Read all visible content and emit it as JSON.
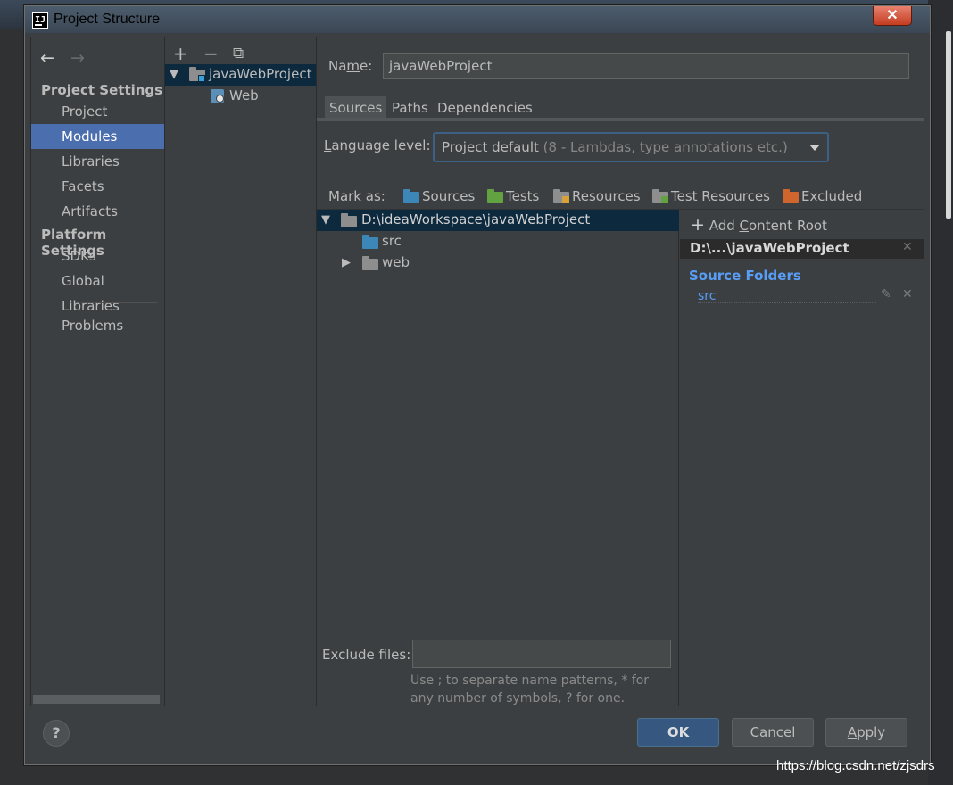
{
  "window": {
    "title": "Project Structure",
    "close_glyph": "✕"
  },
  "nav": {
    "back_glyph": "←",
    "forward_glyph": "→"
  },
  "sidebar": {
    "project_settings_header": "Project Settings",
    "project_items": [
      {
        "label": "Project",
        "selected": false
      },
      {
        "label": "Modules",
        "selected": true
      },
      {
        "label": "Libraries",
        "selected": false
      },
      {
        "label": "Facets",
        "selected": false
      },
      {
        "label": "Artifacts",
        "selected": false
      }
    ],
    "platform_settings_header": "Platform Settings",
    "platform_items": [
      {
        "label": "SDKs"
      },
      {
        "label": "Global Libraries"
      }
    ],
    "problems_label": "Problems"
  },
  "module_tree": {
    "toolbar": {
      "add_glyph": "+",
      "remove_glyph": "−",
      "copy_glyph": "⧉"
    },
    "root": {
      "label": "javaWebProject",
      "expanded": true
    },
    "children": [
      {
        "label": "Web"
      }
    ]
  },
  "module_settings": {
    "name_label": "Name:",
    "name_value": "javaWebProject",
    "tabs": [
      {
        "label": "Sources",
        "selected": true
      },
      {
        "label": "Paths",
        "selected": false
      },
      {
        "label": "Dependencies",
        "selected": false
      }
    ],
    "language_level": {
      "label": "Language level:",
      "value": "Project default",
      "hint": "(8 - Lambdas, type annotations etc.)"
    },
    "mark_as": {
      "label": "Mark as:",
      "items": [
        {
          "label": "Sources",
          "color": "#3d87b8"
        },
        {
          "label": "Tests",
          "color": "#62a240"
        },
        {
          "label": "Resources",
          "color": "#8e8e8e"
        },
        {
          "label": "Test Resources",
          "color": "#8e8e8e"
        },
        {
          "label": "Excluded",
          "color": "#d0662e"
        }
      ]
    },
    "content_tree": {
      "root": "D:\\ideaWorkspace\\javaWebProject",
      "children": [
        {
          "label": "src",
          "color": "#3d87b8",
          "expandable": false
        },
        {
          "label": "web",
          "color": "#8e8e8e",
          "expandable": true
        }
      ]
    },
    "content_roots": {
      "add_label": "Add Content Root",
      "root_title": "D:\\...\\javaWebProject",
      "source_folders_header": "Source Folders",
      "source_folders": [
        "src"
      ]
    },
    "exclude_files": {
      "label": "Exclude files:",
      "value": "",
      "hint_line1": "Use ; to separate name patterns, * for",
      "hint_line2": "any number of symbols, ? for one."
    }
  },
  "footer": {
    "help_glyph": "?",
    "ok_label": "OK",
    "cancel_label": "Cancel",
    "apply_label": "Apply"
  },
  "watermark": "https://blog.csdn.net/zjsdrs",
  "colors": {
    "accent_selection": "#4b6eaf",
    "tree_selection": "#0d293e",
    "source_folders_header": "#589df6",
    "ok_button": "#365880"
  }
}
